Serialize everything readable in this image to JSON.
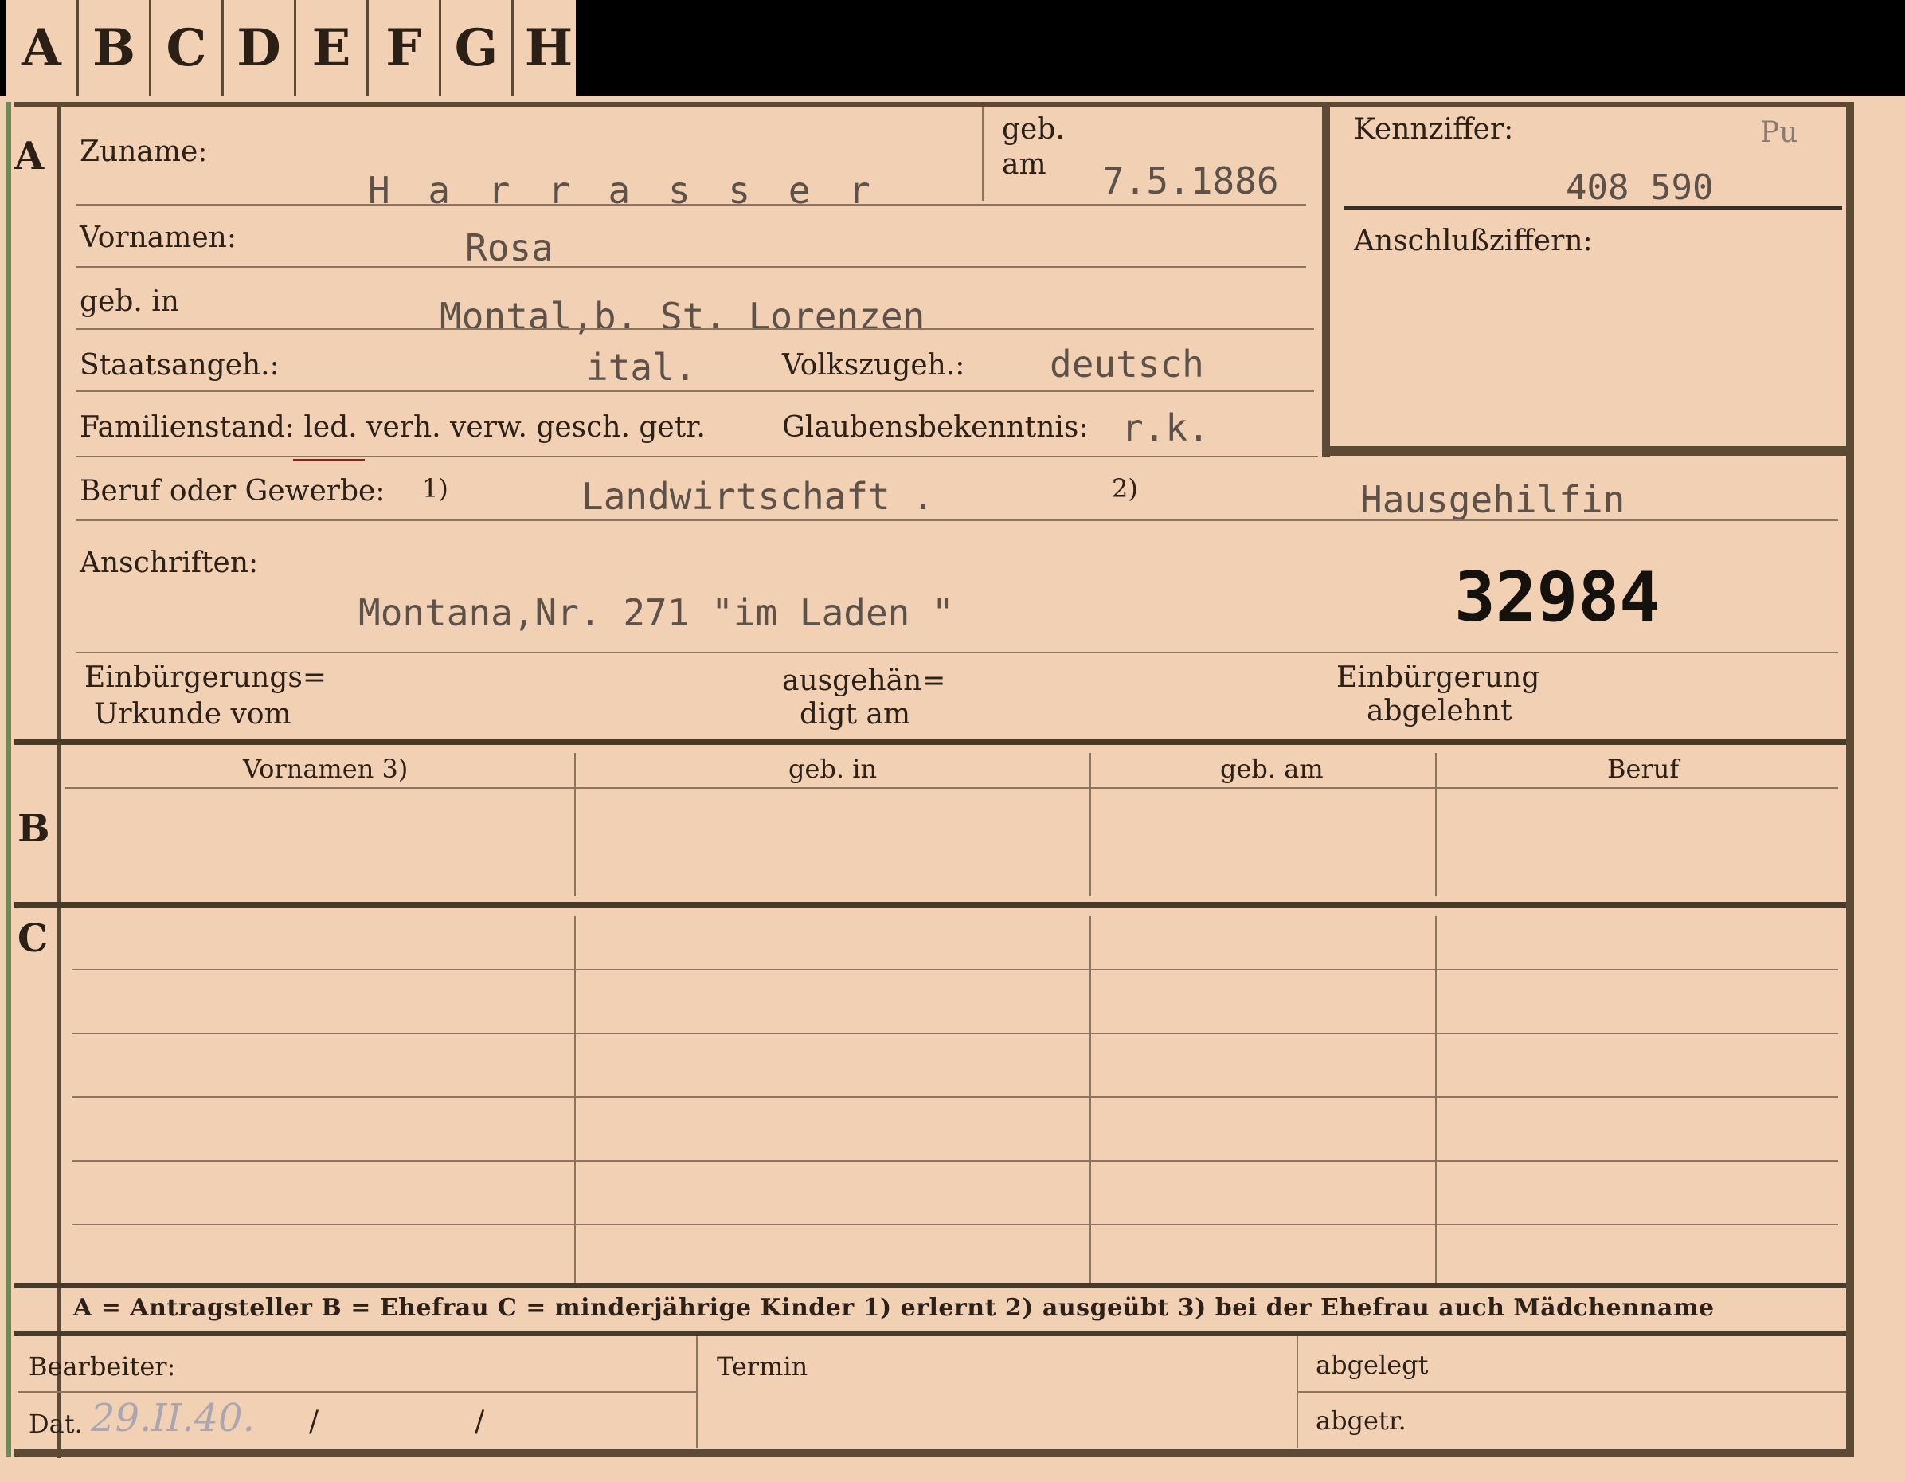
{
  "tabs": [
    "A",
    "B",
    "C",
    "D",
    "E",
    "F",
    "G",
    "H"
  ],
  "section_a": {
    "marker": "A",
    "zuname_label": "Zuname:",
    "zuname_value": "H a r r a s s e r",
    "geb_label": "geb.",
    "am_label": "am",
    "geb_am_value": "7.5.1886",
    "kennziffer_label": "Kennziffer:",
    "kennziffer_code": "Pu",
    "kennziffer_value": "408 590",
    "anschluss_label": "Anschlußziffern:",
    "vornamen_label": "Vornamen:",
    "vornamen_value": "Rosa",
    "geb_in_label": "geb. in",
    "geb_in_value": "Montal,b. St. Lorenzen",
    "staatsangeh_label": "Staatsangeh.:",
    "staatsangeh_value": "ital.",
    "volkszugeh_label": "Volkszugeh.:",
    "volkszugeh_value": "deutsch",
    "familienstand_label": "Familienstand: led. verh. verw. gesch. getr.",
    "glaubens_label": "Glaubensbekenntnis:",
    "glaubens_value": "r.k.",
    "beruf_label": "Beruf oder Gewerbe:",
    "beruf_marker1": "1)",
    "beruf_value1": "Landwirtschaft .",
    "beruf_marker2": "2)",
    "beruf_value2": "Hausgehilfin",
    "anschriften_label": "Anschriften:",
    "anschriften_value": "Montana,Nr. 271 \"im  Laden \"",
    "stamp_number": "32984",
    "einb_urkunde_label_1": "Einbürgerungs=",
    "einb_urkunde_label_2": "Urkunde vom",
    "ausgehaendigt_label_1": "ausgehän=",
    "ausgehaendigt_label_2": "digt am",
    "einb_abgelehnt_label_1": "Einbürgerung",
    "einb_abgelehnt_label_2": "abgelehnt"
  },
  "section_b": {
    "marker": "B",
    "columns": [
      "Vornamen 3)",
      "geb. in",
      "geb. am",
      "Beruf"
    ]
  },
  "section_c": {
    "marker": "C"
  },
  "legend": "A = Antragsteller   B = Ehefrau   C = minderjährige Kinder   1) erlernt   2) ausgeübt   3) bei der Ehefrau auch Mädchenname",
  "footer": {
    "bearbeiter_label": "Bearbeiter:",
    "dat_label": "Dat.",
    "dat_value": "29.II.40.",
    "slash1": "/",
    "slash2": "/",
    "termin_label": "Termin",
    "abgelegt_label": "abgelegt",
    "abgetr_label": "abgetr."
  }
}
